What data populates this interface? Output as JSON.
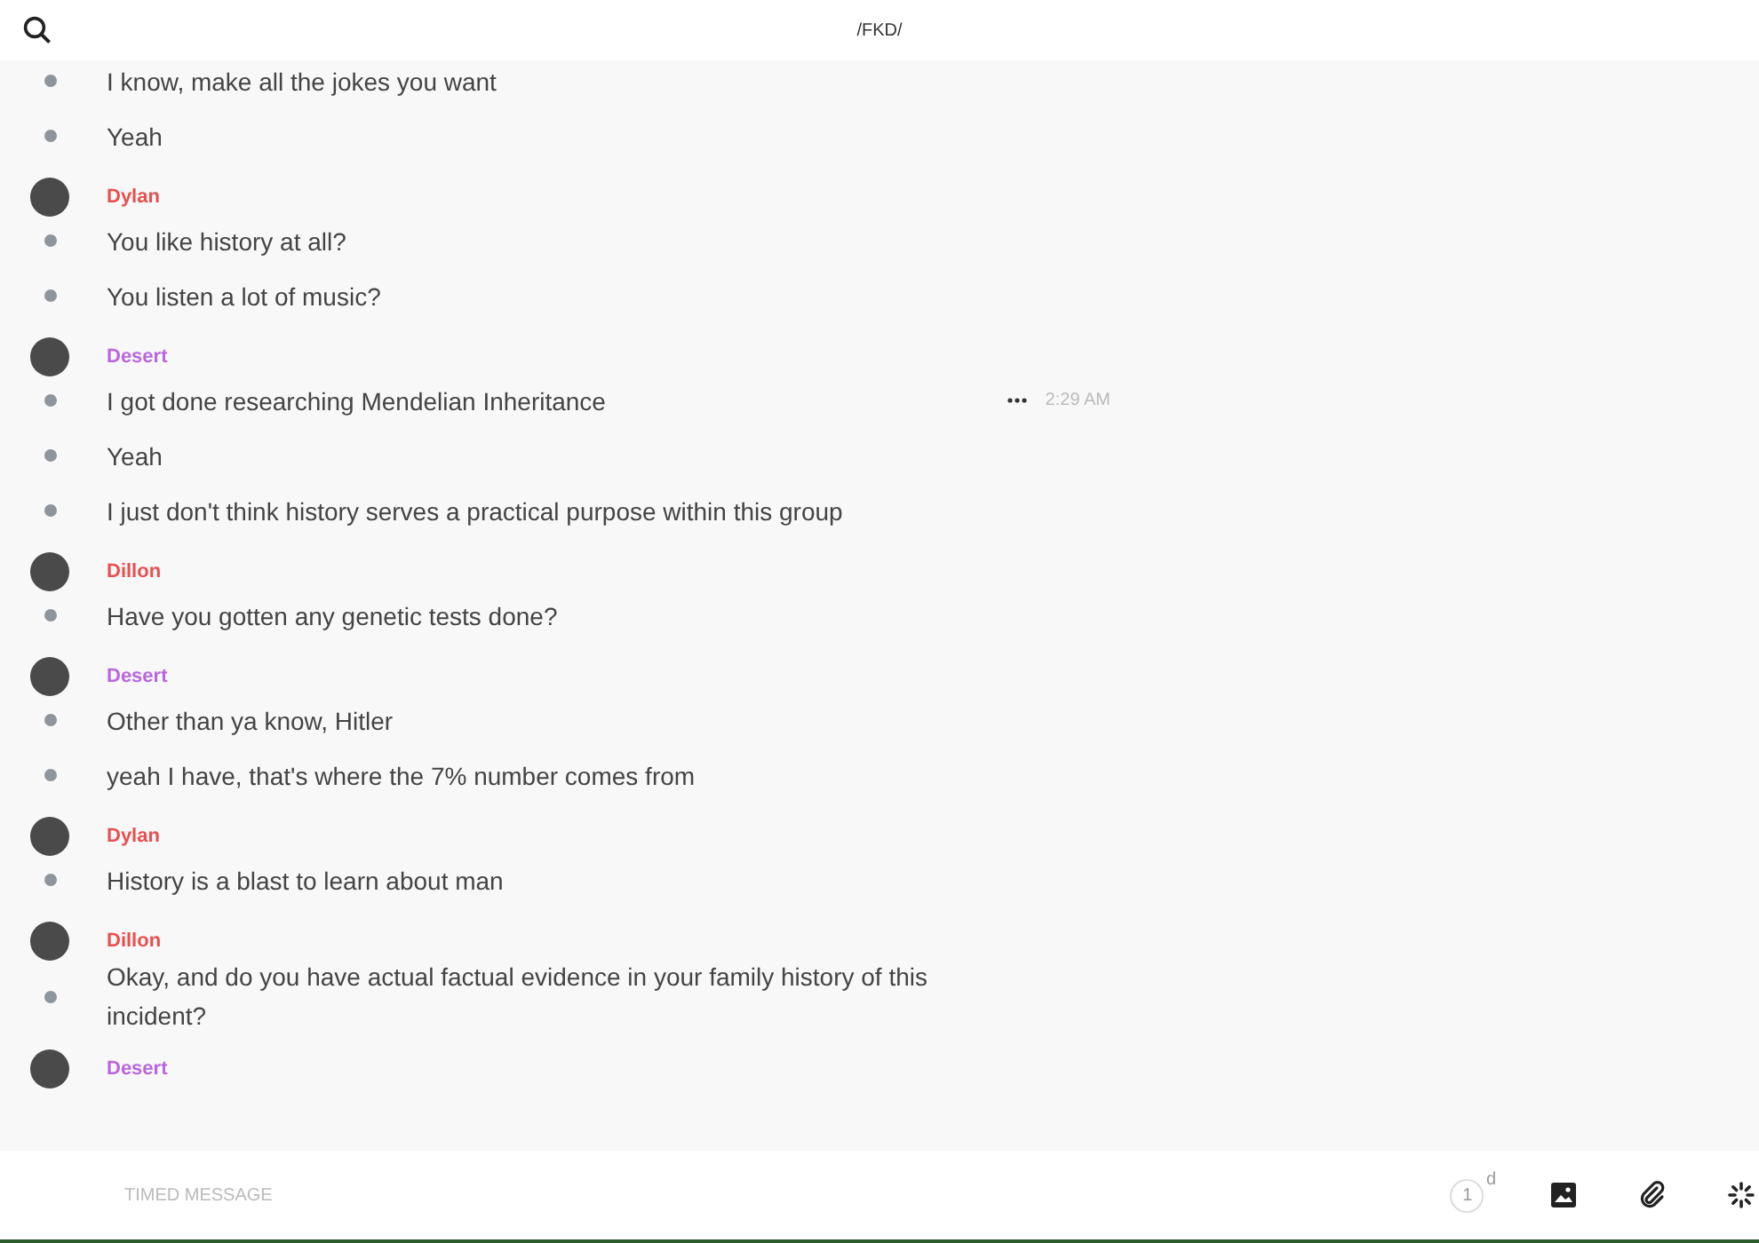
{
  "header": {
    "title": "/FKD/"
  },
  "groups": [
    {
      "messages": [
        {
          "text": "I know, make all the jokes you want"
        },
        {
          "text": "Yeah"
        }
      ]
    },
    {
      "author": "Dylan",
      "color": "#e8504f",
      "messages": [
        {
          "text": "You like history at all?"
        },
        {
          "text": "You listen a lot of music?"
        }
      ]
    },
    {
      "author": "Desert",
      "color": "#b966e0",
      "messages": [
        {
          "text": "I got done researching Mendelian Inheritance",
          "time": "2:29 AM"
        },
        {
          "text": "Yeah"
        },
        {
          "text": "I just don't think history serves a practical purpose within this group"
        }
      ]
    },
    {
      "author": "Dillon",
      "color": "#e8504f",
      "messages": [
        {
          "text": "Have you gotten any genetic tests done?"
        }
      ]
    },
    {
      "author": "Desert",
      "color": "#b966e0",
      "messages": [
        {
          "text": "Other than ya know, Hitler"
        },
        {
          "text": "yeah I have, that's where the 7% number comes from"
        }
      ]
    },
    {
      "author": "Dylan",
      "color": "#e8504f",
      "messages": [
        {
          "text": "History is a blast to learn about man"
        }
      ]
    },
    {
      "author": "Dillon",
      "color": "#e8504f",
      "messages": [
        {
          "text": "Okay, and do you have actual factual evidence in your family history of this incident?"
        }
      ]
    },
    {
      "author": "Desert",
      "color": "#b966e0"
    }
  ],
  "composer": {
    "placeholder": "TIMED MESSAGE",
    "timer": "1",
    "timer_unit": "d"
  }
}
